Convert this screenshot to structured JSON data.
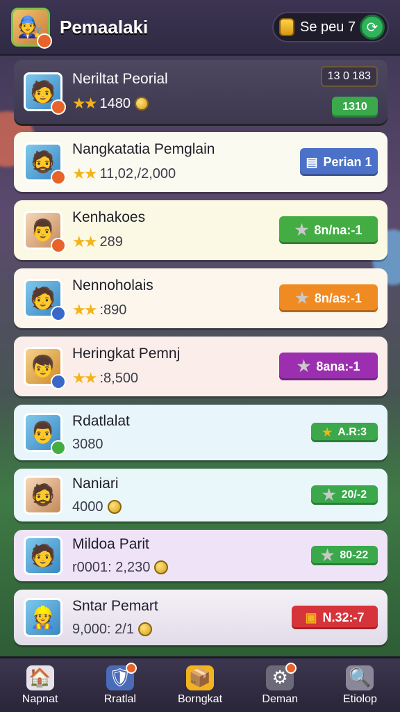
{
  "header": {
    "title": "Pemaalaki",
    "coin_text": "Se peu 7"
  },
  "rows": [
    {
      "name": "Neriltat Peorial",
      "stat": "1480",
      "action": "1310",
      "action_top": "13 0  183",
      "avatar": "🧑",
      "color": "#5b5670",
      "action_color": "#3aa84b"
    },
    {
      "name": "Nangkatatia Pemglain",
      "stat": "11,02,/2,000",
      "action": "Perian 1",
      "avatar": "🧔",
      "color": "#fbfaf0",
      "action_color": "#4b72c8"
    },
    {
      "name": "Kenhakoes",
      "stat": "289",
      "action": "8n/na:-1",
      "avatar": "👨",
      "color": "#fbf8e3",
      "action_color": "#43ad43"
    },
    {
      "name": "Nennoholais",
      "stat": ":890",
      "action": "8n/as:-1",
      "avatar": "🧑",
      "color": "#fcf6ec",
      "action_color": "#f08a22"
    },
    {
      "name": "Heringkat Pemnj",
      "stat": ":8,500",
      "action": "8ana:-1",
      "avatar": "👦",
      "color": "#fbeeea",
      "action_color": "#9b2fb0"
    },
    {
      "name": "Rdatlalat",
      "stat": "3080",
      "action": "A.R:3",
      "avatar": "👨",
      "color": "#e8f6fb",
      "action_color": "#3aa84b"
    },
    {
      "name": "Naniari",
      "stat": "4000",
      "action": "20/-2",
      "avatar": "🧔",
      "color": "#e9f7fb",
      "action_color": "#3aa84b"
    },
    {
      "name": "Mildoa Parit",
      "stat": "r0001: 2,230",
      "action": "80-22",
      "avatar": "🧑",
      "color": "#efe4f7",
      "action_color": "#3aa84b"
    },
    {
      "name": "Sntar Pemart",
      "stat": "9,000: 2/1",
      "action": "N.32:-7",
      "avatar": "👷",
      "color": "#ece8f2",
      "action_color": "#d7333a"
    }
  ],
  "nav": [
    {
      "label": "Napnat",
      "icon": "home-icon",
      "glyph": "🏠"
    },
    {
      "label": "Rratlal",
      "icon": "shield-icon",
      "glyph": "🛡️"
    },
    {
      "label": "Borngkat",
      "icon": "box-icon",
      "glyph": "📦"
    },
    {
      "label": "Deman",
      "icon": "gear-icon",
      "glyph": "⚙️"
    },
    {
      "label": "Etiolop",
      "icon": "search-icon",
      "glyph": "🔍"
    }
  ]
}
